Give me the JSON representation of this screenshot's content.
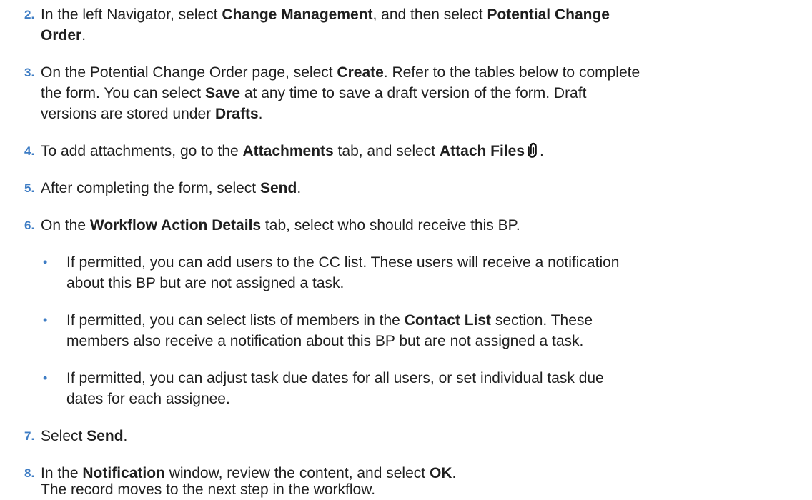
{
  "steps": [
    {
      "number": "2.",
      "lines": [
        [
          "In the left Navigator, select ",
          "Change Management",
          ", and then select ",
          "Potential Change"
        ],
        [
          "",
          "Order",
          "."
        ]
      ]
    },
    {
      "number": "3.",
      "lines": [
        [
          "On the Potential Change Order page, select ",
          "Create",
          ". Refer to the tables below to complete"
        ],
        [
          "the form. You can select ",
          "Save",
          " at any time to save a draft version of the form. Draft"
        ],
        [
          "versions are stored under ",
          "Drafts",
          "."
        ]
      ]
    },
    {
      "number": "4.",
      "lines": [
        [
          "To add attachments, go to the ",
          "Attachments",
          " tab, and select ",
          "Attach Files",
          "",
          "."
        ]
      ],
      "icon": "paperclip-icon"
    },
    {
      "number": "5.",
      "lines": [
        [
          "After completing the form, select ",
          "Send",
          "."
        ]
      ]
    },
    {
      "number": "6.",
      "lines": [
        [
          "On the ",
          "Workflow Action Details",
          " tab, select who should receive this BP."
        ]
      ],
      "bullets": [
        {
          "symbol": "•",
          "lines": [
            [
              "If permitted, you can add users to the CC list. These users will receive a notification"
            ],
            [
              "about this BP but are not assigned a task."
            ]
          ]
        },
        {
          "symbol": "•",
          "lines": [
            [
              "If permitted, you can select lists of members in the ",
              "Contact List",
              " section. These"
            ],
            [
              "members also receive a notification about this BP but are not assigned a task."
            ]
          ]
        },
        {
          "symbol": "•",
          "lines": [
            [
              "If permitted, you can adjust task due dates for all users, or set individual task due"
            ],
            [
              "dates for each assignee."
            ]
          ]
        }
      ]
    },
    {
      "number": "7.",
      "lines": [
        [
          "Select ",
          "Send",
          "."
        ]
      ]
    },
    {
      "number": "8.",
      "lines": [
        [
          "In the ",
          "Notification",
          " window, review the content, and select ",
          "OK",
          "."
        ],
        [
          "The record moves to the next step in the workflow."
        ]
      ]
    }
  ],
  "colors": {
    "step_number": "#3d7cc4",
    "text": "#1f1f1f"
  }
}
